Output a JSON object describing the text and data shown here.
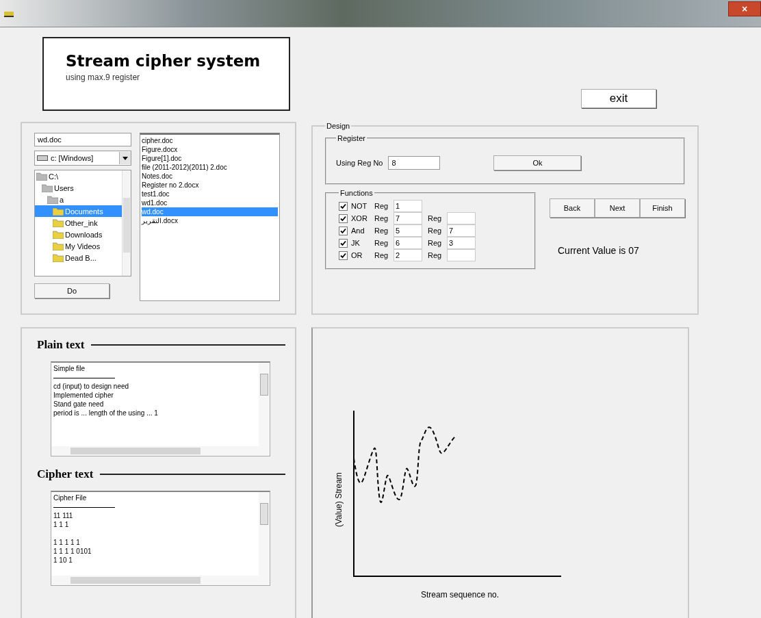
{
  "window": {
    "close_button": "×"
  },
  "header": {
    "title": "Stream cipher system",
    "subtitle": "using max.9 register"
  },
  "exit_button": "exit",
  "file_browser": {
    "file_name": "wd.doc",
    "drive": "c: [Windows]",
    "folders": [
      {
        "label": "C:\\",
        "selected": false,
        "children": [
          {
            "label": "Users",
            "selected": false,
            "children": [
              {
                "label": "a",
                "selected": false,
                "children": [
                  {
                    "label": "Documents",
                    "selected": true
                  },
                  {
                    "label": "Other_ink",
                    "selected": false
                  },
                  {
                    "label": "Downloads",
                    "selected": false
                  },
                  {
                    "label": "My Videos",
                    "selected": false
                  },
                  {
                    "label": "Dead B...",
                    "selected": false
                  }
                ]
              }
            ]
          }
        ]
      }
    ],
    "open_button": "Do",
    "files": [
      {
        "label": "cipher.doc",
        "selected": false
      },
      {
        "label": "Figure.docx",
        "selected": false
      },
      {
        "label": "Figure[1].doc",
        "selected": false
      },
      {
        "label": "file (2011-2012)(2011) 2.doc",
        "selected": false
      },
      {
        "label": "Notes.doc",
        "selected": false
      },
      {
        "label": "Register no 2.docx",
        "selected": false
      },
      {
        "label": "test1.doc",
        "selected": false
      },
      {
        "label": "wd1.doc",
        "selected": false
      },
      {
        "label": "wd.doc",
        "selected": true
      },
      {
        "label": "التقرير.docx",
        "selected": false
      }
    ]
  },
  "design": {
    "legend": "Design",
    "register": {
      "legend": "Register",
      "label": "Using Reg No",
      "value": "8",
      "ok_button": "Ok"
    },
    "functions": {
      "legend": "Functions",
      "rows": [
        {
          "checked": true,
          "name": "NOT",
          "reg_label": "Reg",
          "reg": "1"
        },
        {
          "checked": true,
          "name": "XOR",
          "reg_label": "Reg",
          "reg": "7",
          "reg2_label": "Reg",
          "reg2": ""
        },
        {
          "checked": true,
          "name": "And",
          "reg_label": "Reg",
          "reg": "5",
          "reg2_label": "Reg",
          "reg2": "7"
        },
        {
          "checked": true,
          "name": "JK",
          "reg_label": "Reg",
          "reg": "6",
          "reg2_label": "Reg",
          "reg2": "3"
        },
        {
          "checked": true,
          "name": "OR",
          "reg_label": "Reg",
          "reg": "2",
          "reg2_label": "Reg",
          "reg2": ""
        }
      ]
    },
    "nav_buttons": [
      "Back",
      "Next",
      "Finish"
    ],
    "current_value": "Current  Value is 07"
  },
  "plain_text": {
    "heading": "Plain text",
    "file_header": "Simple file",
    "blocks": [
      [
        "cd (input) to design need",
        "Implemented cipher",
        "Stand gate need",
        "period is ... length of the using ... 1"
      ]
    ]
  },
  "cipher_text": {
    "heading": "Cipher text",
    "file_header": "Cipher File",
    "blocks": [
      [
        "11 111",
        "1 1 1"
      ],
      [
        "1 1 1 1 1",
        "1 1 1 1  0101",
        "1 10 1"
      ]
    ]
  },
  "chart": {
    "ylabel": "(Value) Stream",
    "xlabel": "Stream sequence no."
  }
}
